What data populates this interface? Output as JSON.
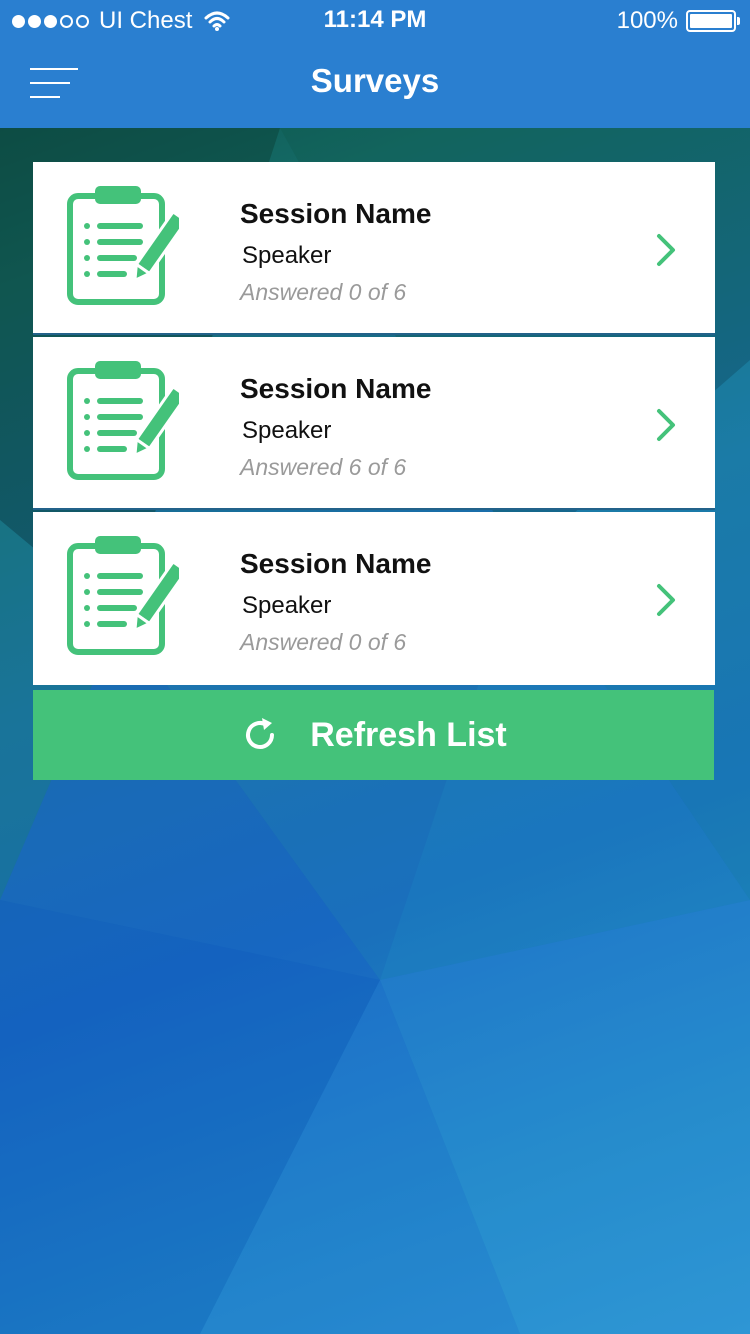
{
  "status_bar": {
    "carrier": "UI Chest",
    "time": "11:14 PM",
    "battery": "100%",
    "signal_dots_filled": 3,
    "signal_dots_total": 5
  },
  "header": {
    "title": "Surveys",
    "menu_icon": "hamburger-menu-icon"
  },
  "surveys": [
    {
      "session_name": "Session Name",
      "speaker": "Speaker",
      "answered": "Answered 0 of 6",
      "icon": "clipboard-pencil-icon"
    },
    {
      "session_name": "Session Name",
      "speaker": "Speaker",
      "answered": "Answered 6 of 6",
      "icon": "clipboard-pencil-icon"
    },
    {
      "session_name": "Session Name",
      "speaker": "Speaker",
      "answered": "Answered 0 of 6",
      "icon": "clipboard-pencil-icon"
    }
  ],
  "refresh_button": {
    "label": "Refresh List",
    "icon": "refresh-icon"
  },
  "colors": {
    "header_blue": "#2a7fd0",
    "accent_green": "#44c27a",
    "answered_gray": "#9a9a9a"
  }
}
